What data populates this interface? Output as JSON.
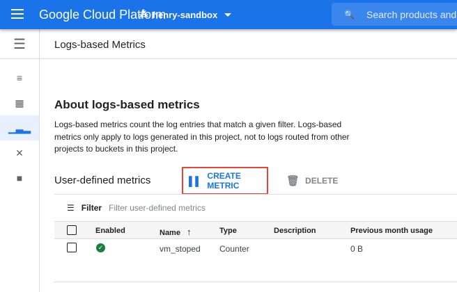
{
  "topbar": {
    "title": "Google Cloud Platform",
    "project": "henry-sandbox",
    "search_placeholder": "Search products and"
  },
  "sidebar": {
    "items": [
      {
        "icon": "list-icon"
      },
      {
        "icon": "dashboard-icon"
      },
      {
        "icon": "bar-chart-icon",
        "active": true
      },
      {
        "icon": "shuffle-icon"
      },
      {
        "icon": "note-icon"
      }
    ]
  },
  "page": {
    "title": "Logs-based Metrics"
  },
  "about": {
    "heading": "About logs-based metrics",
    "text": "Logs-based metrics count the log entries that match a given filter. Logs-based metrics only apply to logs generated in this project, not to logs routed from other projects to buckets in this project."
  },
  "metrics": {
    "heading": "User-defined metrics",
    "create_label": "CREATE METRIC",
    "delete_label": "DELETE",
    "filter_label": "Filter",
    "filter_placeholder": "Filter user-defined metrics",
    "columns": [
      "Enabled",
      "Name",
      "Type",
      "Description",
      "Previous month usage"
    ],
    "rows": [
      {
        "enabled": true,
        "name": "vm_stoped",
        "type": "Counter",
        "description": "",
        "usage": "0 B"
      }
    ]
  },
  "colors": {
    "brand": "#1a73e8",
    "highlight": "#ea4335",
    "enabled": "#188038"
  }
}
